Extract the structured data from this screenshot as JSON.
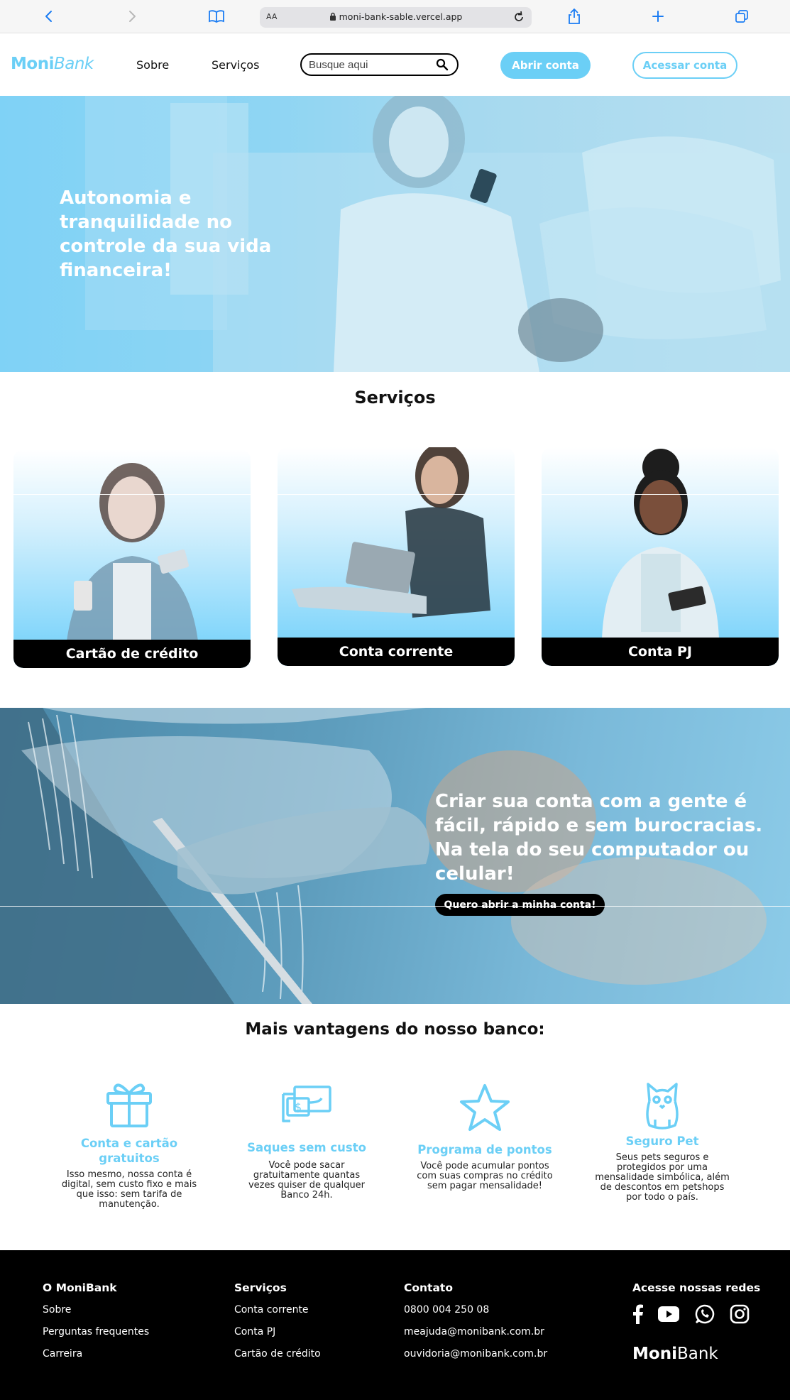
{
  "browser": {
    "aa_label": "AA",
    "url": "moni-bank-sable.vercel.app"
  },
  "header": {
    "logo_bold": "Moni",
    "logo_italic": "Bank",
    "nav": [
      "Sobre",
      "Serviços"
    ],
    "search_placeholder": "Busque aqui",
    "open_account": "Abrir conta",
    "access_account": "Acessar conta"
  },
  "hero": {
    "title": "Autonomia e tranquilidade no controle da sua vida financeira!"
  },
  "services": {
    "title": "Serviços",
    "cards": [
      "Cartão de crédito",
      "Conta corrente",
      "Conta PJ"
    ]
  },
  "banner": {
    "title": "Criar sua conta com a gente é fácil, rápido e sem burocracias. Na tela do seu computador ou celular!",
    "button": "Quero abrir a minha conta!"
  },
  "advantages": {
    "title": "Mais vantagens do nosso banco:",
    "items": [
      {
        "name": "Conta e cartão gratuitos",
        "desc": "Isso mesmo, nossa conta é digital, sem custo fixo e mais que isso: sem tarifa de manutenção.",
        "icon": "gift-icon"
      },
      {
        "name": "Saques sem custo",
        "desc": "Você pode sacar gratuitamente quantas vezes quiser de qualquer Banco 24h.",
        "icon": "cash-withdraw-icon"
      },
      {
        "name": "Programa de pontos",
        "desc": "Você pode acumular pontos com suas compras no crédito sem pagar mensalidade!",
        "icon": "star-icon"
      },
      {
        "name": "Seguro Pet",
        "desc": "Seus pets seguros e protegidos por uma mensalidade simbólica, além de descontos em petshops por todo o país.",
        "icon": "cat-icon"
      }
    ]
  },
  "footer": {
    "col1": {
      "title": "O MoniBank",
      "items": [
        "Sobre",
        "Perguntas frequentes",
        "Carreira"
      ]
    },
    "col2": {
      "title": "Serviços",
      "items": [
        "Conta corrente",
        "Conta PJ",
        "Cartão de crédito"
      ]
    },
    "col3": {
      "title": "Contato",
      "items": [
        "0800 004 250 08",
        "meajuda@monibank.com.br",
        "ouvidoria@monibank.com.br"
      ]
    },
    "col4": {
      "title": "Acesse nossas redes",
      "socials": [
        "facebook-icon",
        "youtube-icon",
        "whatsapp-icon",
        "instagram-icon"
      ]
    },
    "logo_bold": "Moni",
    "logo_regular": "Bank"
  },
  "colors": {
    "accent": "#6bcff6",
    "dark": "#000000"
  }
}
